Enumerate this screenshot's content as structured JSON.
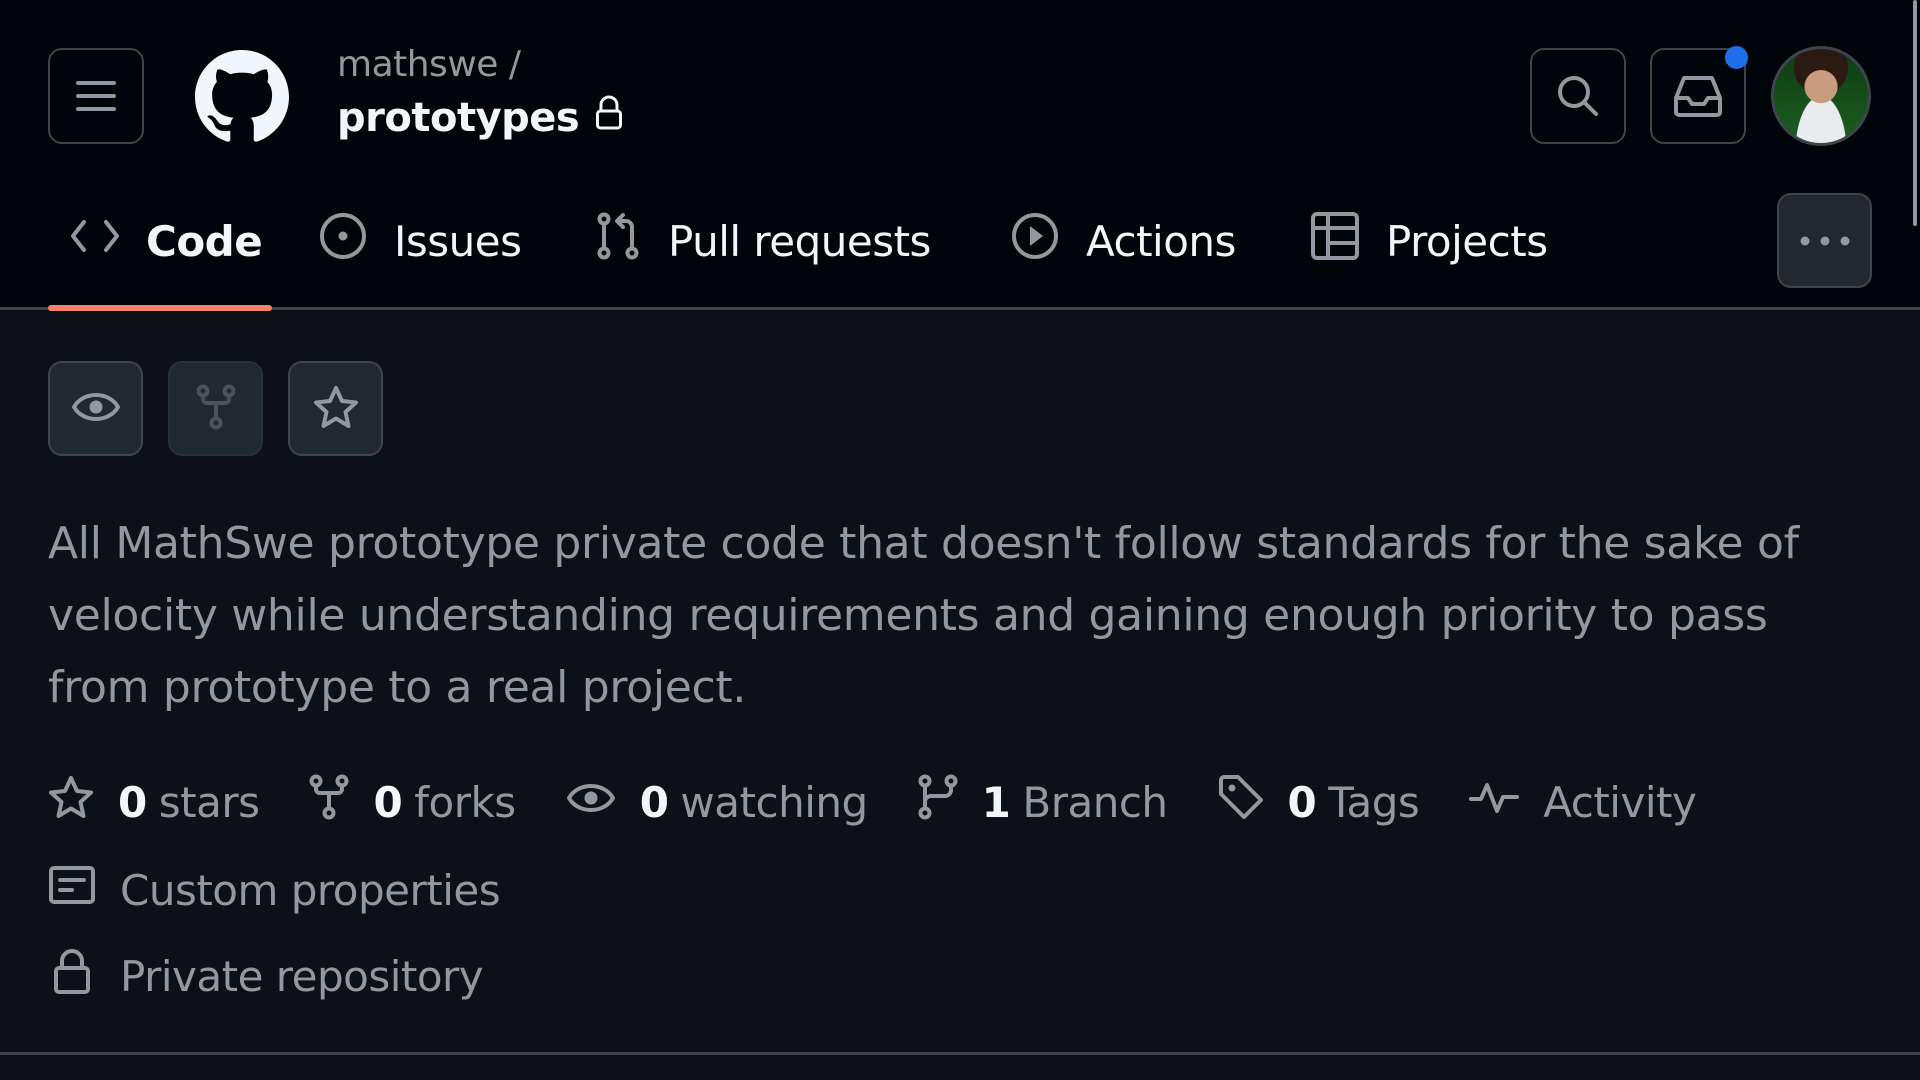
{
  "header": {
    "owner": "mathswe /",
    "repo_name": "prototypes",
    "visibility_icon": "lock-icon",
    "menu_icon": "hamburger-icon",
    "logo_icon": "github-logo-icon",
    "search_icon": "search-icon",
    "inbox_icon": "inbox-icon",
    "has_unread_notifications": true,
    "notification_dot_color": "#1f6feb",
    "avatar": "user-avatar"
  },
  "nav": {
    "tabs": [
      {
        "label": "Code",
        "icon": "code-icon",
        "active": true
      },
      {
        "label": "Issues",
        "icon": "issue-opened-icon",
        "active": false
      },
      {
        "label": "Pull requests",
        "icon": "git-pull-request-icon",
        "active": false
      },
      {
        "label": "Actions",
        "icon": "play-icon",
        "active": false
      },
      {
        "label": "Projects",
        "icon": "table-icon",
        "active": false
      }
    ],
    "more_icon": "kebab-horizontal-icon",
    "active_underline_color": "#f78166"
  },
  "repo_actions": [
    {
      "name": "watch",
      "icon": "eye-icon",
      "enabled": true
    },
    {
      "name": "fork",
      "icon": "repo-forked-icon",
      "enabled": false
    },
    {
      "name": "star",
      "icon": "star-icon",
      "enabled": true
    }
  ],
  "description": "All MathSwe prototype private code that doesn't follow standards for the sake of velocity while understanding requirements and gaining enough priority to pass from prototype to a real project.",
  "stats": [
    {
      "icon": "star-icon",
      "count": "0",
      "label": "stars"
    },
    {
      "icon": "repo-forked-icon",
      "count": "0",
      "label": "forks"
    },
    {
      "icon": "eye-icon",
      "count": "0",
      "label": "watching"
    },
    {
      "icon": "git-branch-icon",
      "count": "1",
      "label": "Branch"
    },
    {
      "icon": "tag-icon",
      "count": "0",
      "label": "Tags"
    },
    {
      "icon": "pulse-icon",
      "count": "",
      "label": "Activity"
    }
  ],
  "meta": {
    "custom_properties": "Custom properties",
    "private_repository": "Private repository"
  }
}
